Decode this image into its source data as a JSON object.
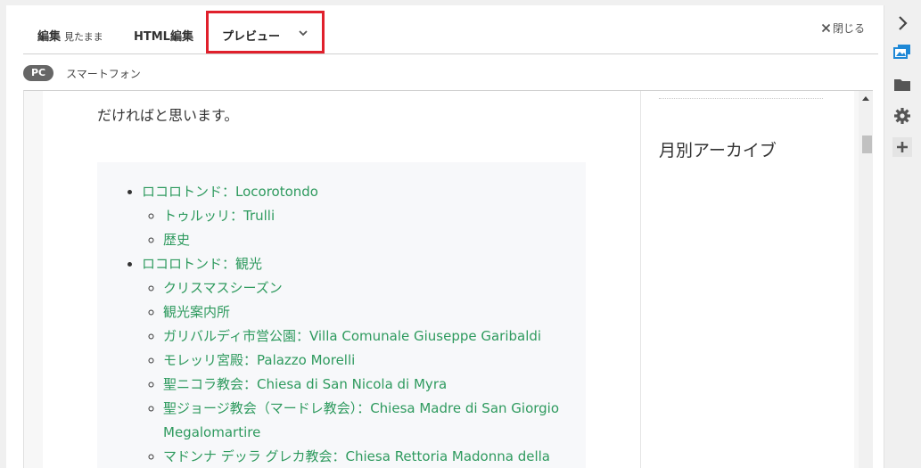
{
  "tabs": {
    "edit_label": "編集",
    "edit_sub": "見たまま",
    "html_label": "HTML編集",
    "preview_label": "プレビュー"
  },
  "close_label": "閉じる",
  "device": {
    "pc": "PC",
    "smartphone": "スマートフォン"
  },
  "article": {
    "intro": "だければと思います。",
    "toc": [
      {
        "label": "ロコロトンド：Locorotondo",
        "children": [
          "トゥルッリ：Trulli",
          "歴史"
        ]
      },
      {
        "label": "ロコロトンド：観光",
        "children": [
          "クリスマスシーズン",
          "観光案内所",
          "ガリバルディ市営公園：Villa Comunale Giuseppe Garibaldi",
          "モレッリ宮殿：Palazzo Morelli",
          "聖ニコラ教会：Chiesa di San Nicola di Myra",
          "聖ジョージ教会（マードレ教会）：Chiesa Madre di San Giorgio Megalomartire",
          "マドンナ デッラ グレカ教会：Chiesa Rettoria Madonna della"
        ]
      }
    ]
  },
  "sidebar": {
    "archive_title": "月別アーカイブ"
  },
  "rail_icons": [
    "chevron-right-icon",
    "image-icon",
    "folder-icon",
    "gear-icon",
    "plus-icon"
  ],
  "colors": {
    "link": "#2e9a5e",
    "highlight": "#e0202c"
  }
}
